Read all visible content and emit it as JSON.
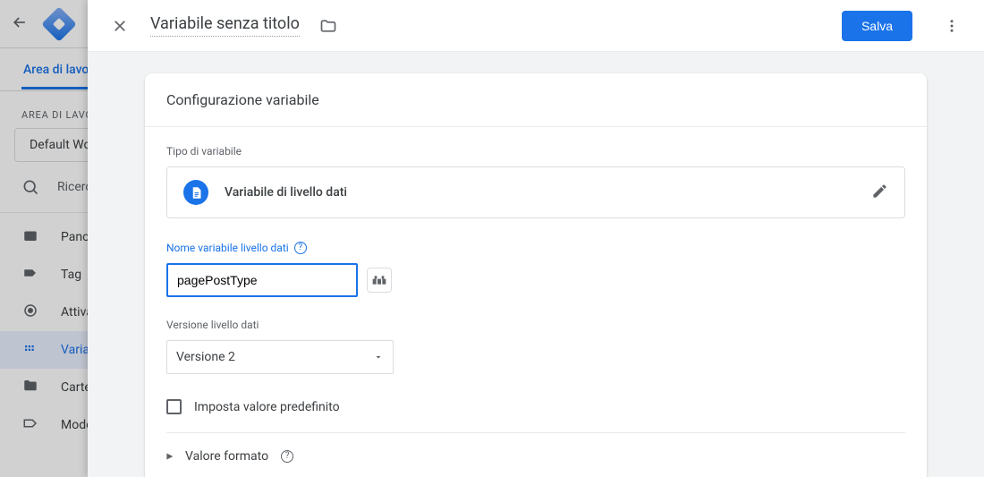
{
  "background": {
    "subnav": {
      "active_tab": "Area di lavoro"
    },
    "section_label": "AREA DI LAVORO ATTUALE",
    "workspace_chip": "Default Workspace",
    "search_placeholder": "Ricerca",
    "nav": {
      "overview": "Panoramica",
      "tags": "Tag",
      "triggers": "Attivatori",
      "variables": "Variabili",
      "folders": "Cartelle",
      "templates": "Modelli"
    }
  },
  "panel": {
    "title": "Variabile senza titolo",
    "save_label": "Salva"
  },
  "card": {
    "title": "Configurazione variabile",
    "type_label": "Tipo di variabile",
    "type_name": "Variabile di livello dati",
    "var_name_label": "Nome variabile livello dati",
    "var_name_value": "pagePostType",
    "version_label": "Versione livello dati",
    "version_value": "Versione 2",
    "default_checkbox": "Imposta valore predefinito",
    "format_label": "Valore formato"
  }
}
